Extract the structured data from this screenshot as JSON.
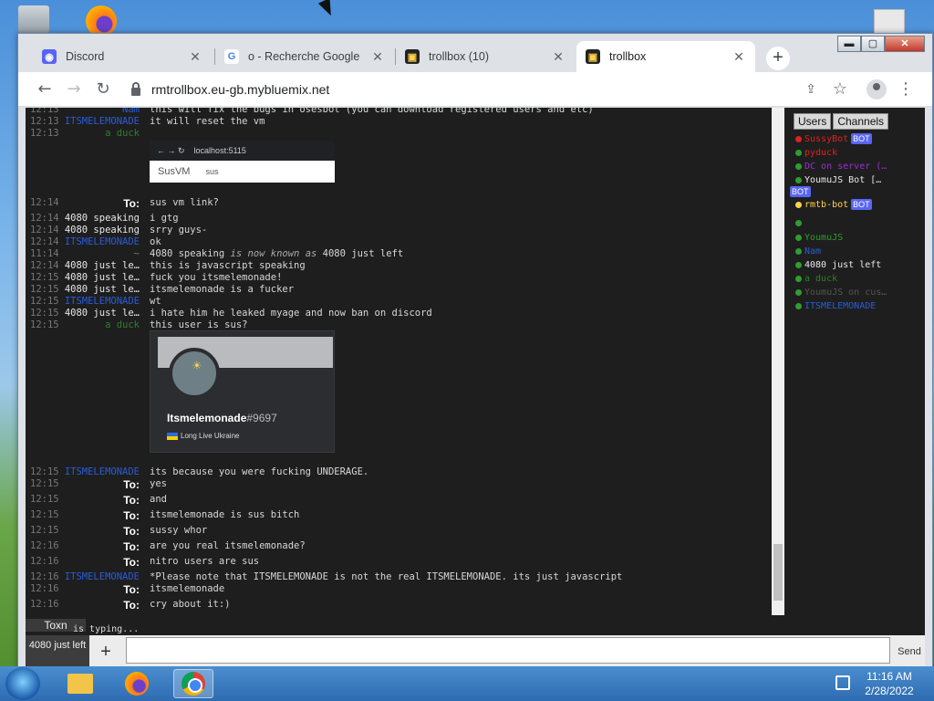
{
  "browser": {
    "tabs": [
      {
        "title": "Discord",
        "icon": "discord-icon"
      },
      {
        "title": "o - Recherche Google",
        "icon": "google-icon"
      },
      {
        "title": "trollbox (10)",
        "icon": "trollbox-icon"
      },
      {
        "title": "trollbox",
        "icon": "trollbox-icon"
      }
    ],
    "url": "rmtrollbox.eu-gb.mybluemix.net"
  },
  "chat": {
    "messages": [
      {
        "time": "12:13",
        "nick": "Nam",
        "color": "blue",
        "text": "this will fix the bugs in osesbot (you can download registered users and etc)"
      },
      {
        "time": "12:13",
        "nick": "ITSMELEMONADE",
        "color": "blue",
        "text": "it will reset the vm"
      },
      {
        "time": "12:13",
        "nick": "a duck",
        "color": "green",
        "text": ""
      },
      {
        "time": "12:14",
        "nick": "To:",
        "color": "tox",
        "text": "sus vm link?"
      },
      {
        "time": "12:14",
        "nick": "4080 speaking",
        "color": "white",
        "text": "i gtg"
      },
      {
        "time": "12:14",
        "nick": "4080 speaking",
        "color": "white",
        "text": "srry guys-"
      },
      {
        "time": "12:14",
        "nick": "ITSMELEMONADE",
        "color": "blue",
        "text": "ok"
      },
      {
        "time": "11:14",
        "nick": "~",
        "color": "gray",
        "text_before": "4080 speaking ",
        "text_italic": "is now known as",
        "text_after": " 4080 just left"
      },
      {
        "time": "12:14",
        "nick": "4080 just le…",
        "color": "white",
        "text": "this is javascript speaking"
      },
      {
        "time": "12:15",
        "nick": "4080 just le…",
        "color": "white",
        "text": "fuck you itsmelemonade!"
      },
      {
        "time": "12:15",
        "nick": "4080 just le…",
        "color": "white",
        "text": "itsmelemonade is a fucker"
      },
      {
        "time": "12:15",
        "nick": "ITSMELEMONADE",
        "color": "blue",
        "text": "wt"
      },
      {
        "time": "12:15",
        "nick": "4080 just le…",
        "color": "white",
        "text": "i hate him he leaked myage and now ban on discord"
      },
      {
        "time": "12:15",
        "nick": "a duck",
        "color": "green",
        "text": "this user is sus?"
      },
      {
        "time": "12:15",
        "nick": "ITSMELEMONADE",
        "color": "blue",
        "text": "its because you were fucking UNDERAGE."
      },
      {
        "time": "12:15",
        "nick": "To:",
        "color": "tox",
        "text": "yes"
      },
      {
        "time": "12:15",
        "nick": "To:",
        "color": "tox",
        "text": "and"
      },
      {
        "time": "12:15",
        "nick": "To:",
        "color": "tox",
        "text": "itsmelemonade is sus bitch"
      },
      {
        "time": "12:15",
        "nick": "To:",
        "color": "tox",
        "text": "sussy whor"
      },
      {
        "time": "12:16",
        "nick": "To:",
        "color": "tox",
        "text": "are you real itsmelemonade?"
      },
      {
        "time": "12:16",
        "nick": "To:",
        "color": "tox",
        "text": "nitro users are sus"
      },
      {
        "time": "12:16",
        "nick": "ITSMELEMONADE",
        "color": "blue",
        "text": "*Please note that ITSMELEMONADE is not the real ITSMELEMONADE. its just javascript"
      },
      {
        "time": "12:16",
        "nick": "To:",
        "color": "tox",
        "text": "itsmelemonade"
      },
      {
        "time": "12:16",
        "nick": "To:",
        "color": "tox",
        "text": "cry about it:)"
      }
    ],
    "embed1": {
      "address": "localhost:5115",
      "title": "SusVM",
      "subtitle": "sus"
    },
    "embed2": {
      "username": "Itsmelemonade",
      "discriminator": "#9697",
      "status": "Long Live Ukraine"
    }
  },
  "users_panel": {
    "tabs": [
      "Users",
      "Channels"
    ],
    "users": [
      {
        "name": "SussyBot",
        "color": "#e02020",
        "bot": true
      },
      {
        "name": "pyduck",
        "color": "#e02020",
        "bot": false
      },
      {
        "name": "DC on server (…",
        "color": "#9b30d0",
        "bot": false
      },
      {
        "name": "YoumuJS Bot […",
        "color": "#e8e8e8",
        "bot": true
      },
      {
        "name": "rmtb-bot",
        "color": "#ffd24a",
        "bot": true
      },
      {
        "name": "",
        "color": "#2f9d2f",
        "bot": false
      },
      {
        "name": "YoumuJS",
        "color": "#2f9d2f",
        "bot": false
      },
      {
        "name": "Nam",
        "color": "#2a5cd8",
        "bot": false
      },
      {
        "name": "4080 just left",
        "color": "#e8e8e8",
        "bot": false
      },
      {
        "name": "a duck",
        "color": "#2f7d2f",
        "bot": false
      },
      {
        "name": "YoumuJS on cus…",
        "color": "#555555",
        "bot": false
      },
      {
        "name": "ITSMELEMONADE",
        "color": "#2a5cd8",
        "bot": false
      }
    ],
    "bot_label": "BOT"
  },
  "input": {
    "typing_user": "Toxn",
    "typing_text": "is typing...",
    "current_user": "4080 just left",
    "send_label": "Send",
    "add_label": "+"
  },
  "taskbar": {
    "time": "11:16 AM",
    "date": "2/28/2022"
  }
}
